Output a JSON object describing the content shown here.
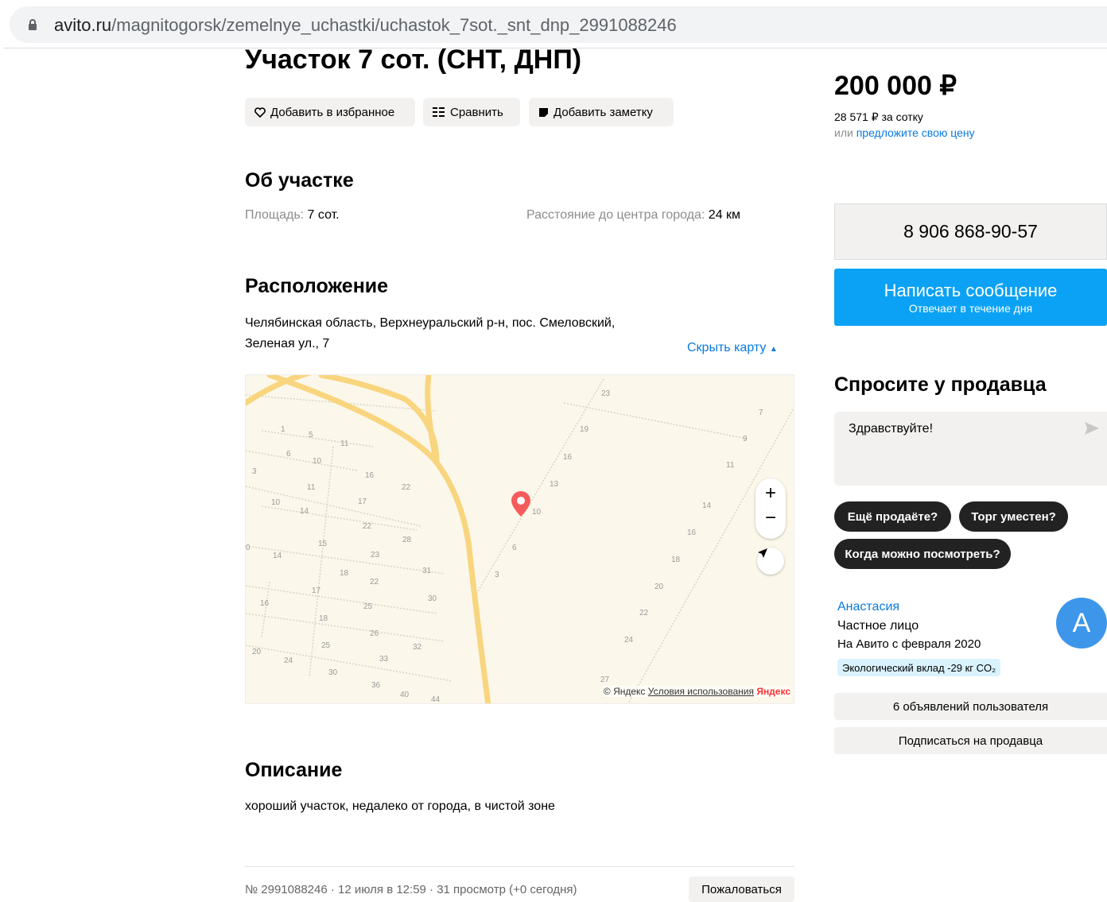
{
  "browser": {
    "url_domain": "avito.ru",
    "url_path": "/magnitogorsk/zemelnye_uchastki/uchastok_7sot._snt_dnp_2991088246"
  },
  "listing": {
    "title": "Участок 7 сот. (СНТ, ДНП)",
    "actions": {
      "favorite": "Добавить в избранное",
      "compare": "Сравнить",
      "note": "Добавить заметку"
    },
    "about": {
      "heading": "Об участке",
      "area_label": "Площадь:",
      "area_value": "7 сот.",
      "distance_label": "Расстояние до центра города:",
      "distance_value": "24 км"
    },
    "location": {
      "heading": "Расположение",
      "address_line1": "Челябинская область, Верхнеуральский р-н, пос. Смеловский,",
      "address_line2": "Зеленая ул., 7",
      "hide_map": "Скрыть карту"
    },
    "map": {
      "copyright": "© Яндекс",
      "terms": "Условия использования",
      "brand": "Яндекс",
      "house_numbers": [
        "1",
        "5",
        "11",
        "6",
        "10",
        "3",
        "16",
        "22",
        "11",
        "17",
        "10",
        "14",
        "22",
        "28",
        "15",
        "23",
        "0",
        "14",
        "18",
        "22",
        "31",
        "17",
        "30",
        "16",
        "25",
        "18",
        "26",
        "32",
        "25",
        "20",
        "24",
        "33",
        "30",
        "36",
        "40",
        "44",
        "23",
        "19",
        "16",
        "13",
        "10",
        "6",
        "3",
        "7",
        "9",
        "11",
        "14",
        "16",
        "18",
        "20",
        "22",
        "24",
        "27"
      ]
    },
    "description": {
      "heading": "Описание",
      "text": "хороший участок, недалеко от города, в чистой зоне"
    },
    "footer": {
      "meta": "№ 2991088246 · 12 июля в 12:59 · 31 просмотр (+0 сегодня)",
      "report": "Пожаловаться"
    }
  },
  "sidebar": {
    "price": "200 000 ₽",
    "price_per": "28 571 ₽ за сотку",
    "offer_prefix": "или",
    "offer_link": "предложите свою цену",
    "phone": "8 906 868-90-57",
    "message_button": "Написать сообщение",
    "message_sub": "Отвечает в течение дня",
    "ask_heading": "Спросите у продавца",
    "ask_placeholder": "Здравствуйте!",
    "chips": [
      "Ещё продаёте?",
      "Торг уместен?",
      "Когда можно посмотреть?"
    ],
    "seller": {
      "name": "Анастасия",
      "type": "Частное лицо",
      "since": "На Авито с февраля 2020",
      "avatar_letter": "A",
      "eco": "Экологический вклад -29 кг CO₂"
    },
    "user_ads": "6 объявлений пользователя",
    "subscribe": "Подписаться на продавца"
  },
  "colors": {
    "accent": "#0ba2f5",
    "link": "#0a7ae0",
    "avatar": "#3d96ea",
    "pin": "#f65b5b",
    "road": "#f8d57e"
  }
}
